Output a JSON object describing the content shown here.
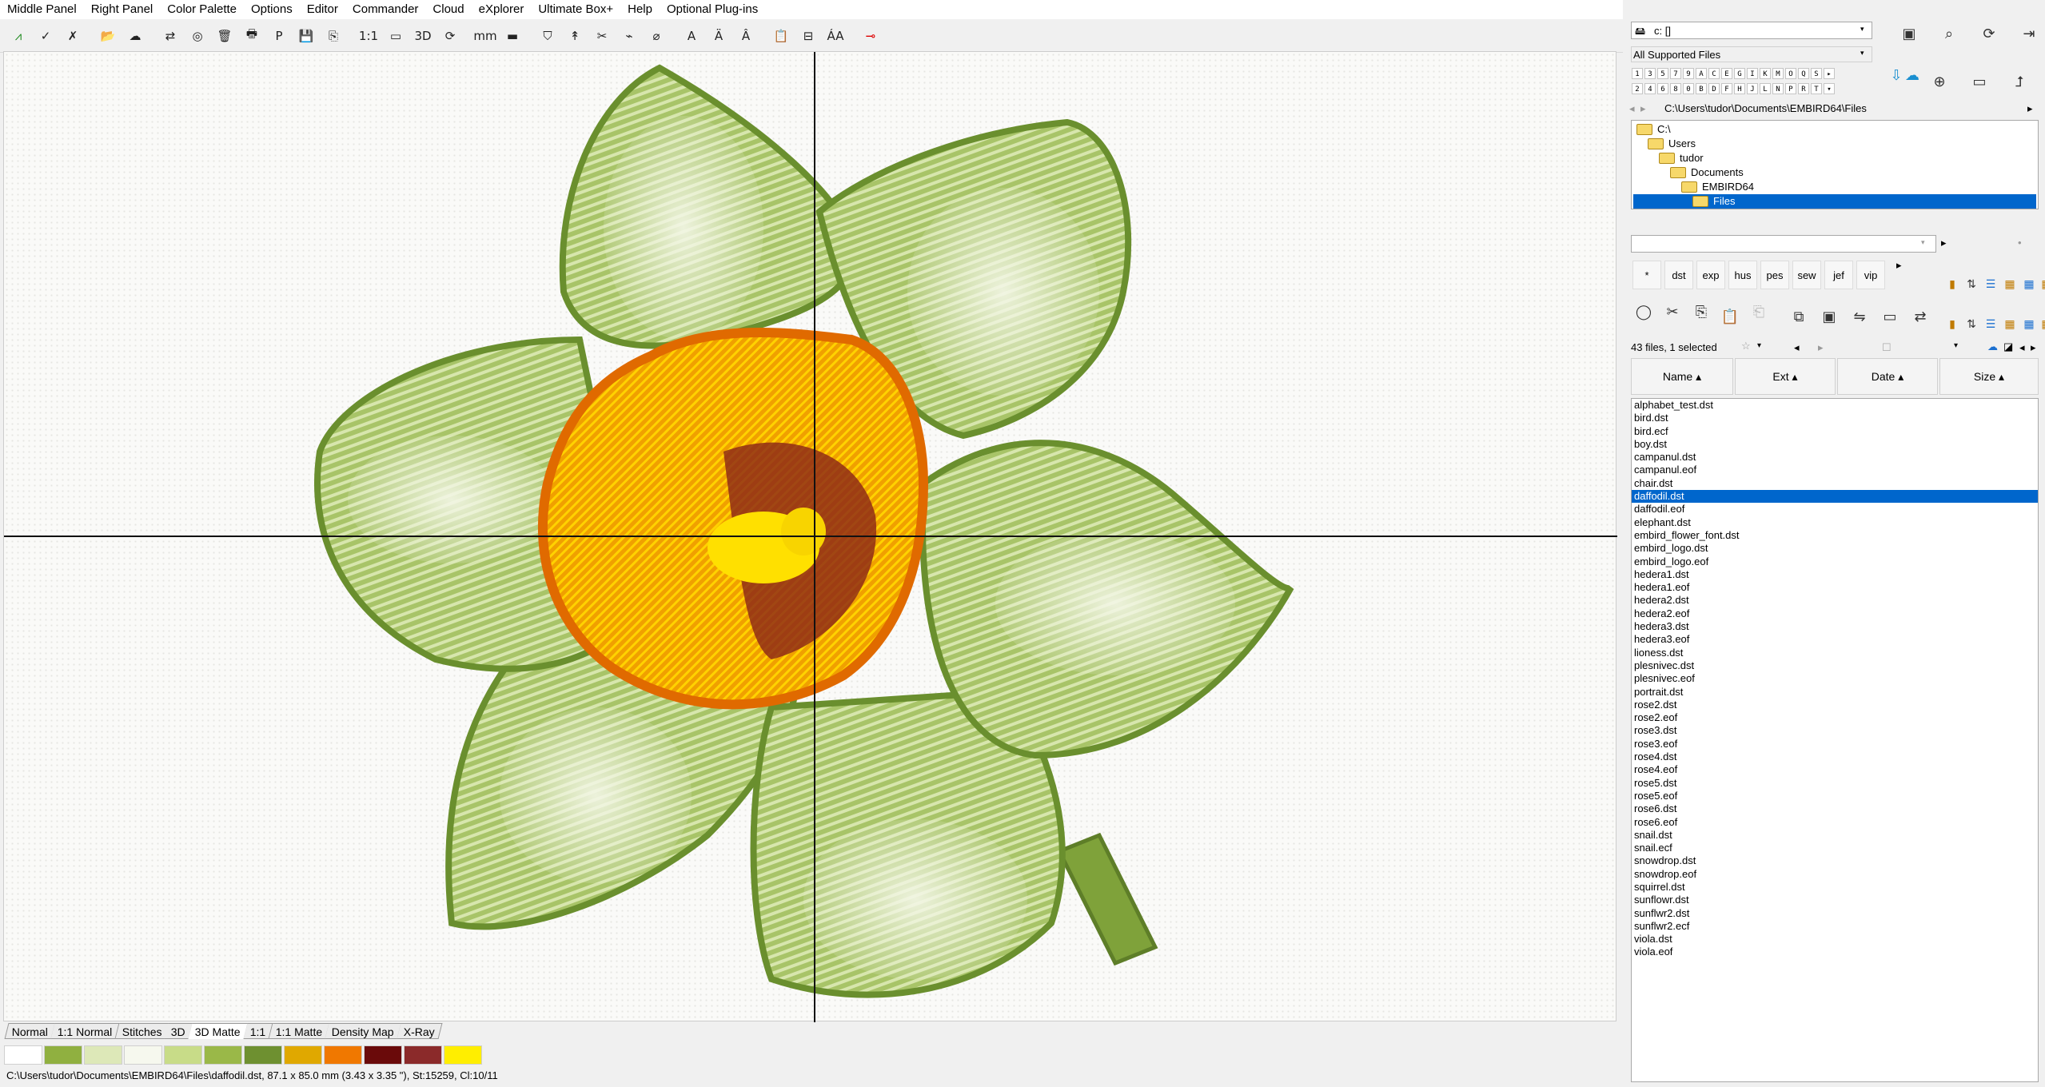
{
  "menu": [
    "Middle Panel",
    "Right Panel",
    "Color Palette",
    "Options",
    "Editor",
    "Commander",
    "Cloud",
    "eXplorer",
    "Ultimate Box+",
    "Help",
    "Optional Plug-ins"
  ],
  "toolbar": {
    "icons": [
      "stitch-logo-icon",
      "wand-check-icon",
      "wand-cross-icon",
      "open-folder-icon",
      "cloud-icon",
      "transfer-icon",
      "hoop-icon",
      "trash-icon",
      "print-icon",
      "pdf-icon",
      "save-icon",
      "save-as-icon",
      "one-to-one-icon",
      "screen-icon",
      "3d-icon",
      "rotate-icon",
      "measure-mm-icon",
      "measure-ruler-icon",
      "shield-icon",
      "needle-icon",
      "stitch-a-icon",
      "stitch-b-icon",
      "stitch-c-icon",
      "text-a-icon",
      "text-b-icon",
      "text-c-icon",
      "clipboard-icon",
      "layout-icon",
      "font-aa-icon",
      "key-red-icon"
    ],
    "glyphs": [
      "⩘",
      "✓",
      "✗",
      "📂",
      "☁",
      "⇄",
      "◎",
      "🗑",
      "🖶",
      "P",
      "💾",
      "⎘",
      "1:1",
      "▭",
      "3D",
      "⟳",
      "mm",
      "▬",
      "⛉",
      "↟",
      "✂",
      "⌁",
      "⌀",
      "A",
      "Ä",
      "Â",
      "📋",
      "⊟",
      "ÁA",
      "⊸"
    ],
    "text_labels": [
      "1:1",
      "3D",
      "mm",
      "A",
      "ÁA"
    ]
  },
  "view_tabs": [
    "Normal",
    "1:1 Normal",
    "Stitches",
    "3D",
    "3D Matte",
    "1:1",
    "1:1 Matte",
    "Density Map",
    "X-Ray"
  ],
  "active_view_tab": "3D Matte",
  "palette": [
    "#ffffff",
    "#90b040",
    "#dde8b8",
    "#f6f8ee",
    "#c8dc88",
    "#9ab848",
    "#6e9030",
    "#e0a800",
    "#f07800",
    "#6a0a0a",
    "#8b2a2a",
    "#ffee00"
  ],
  "status": "C:\\Users\\tudor\\Documents\\EMBIRD64\\Files\\daffodil.dst, 87.1 x 85.0 mm (3.43 x 3.35 \"), St:15259, Cl:10/11",
  "right_panel": {
    "drive": "c: []",
    "file_type": "All Supported Files",
    "key_rows": [
      [
        "1",
        "3",
        "5",
        "7",
        "9",
        "A",
        "C",
        "E",
        "G",
        "I",
        "K",
        "M",
        "O",
        "Q",
        "S",
        "▸"
      ],
      [
        "2",
        "4",
        "6",
        "8",
        "0",
        "B",
        "D",
        "F",
        "H",
        "J",
        "L",
        "N",
        "P",
        "R",
        "T",
        "▾"
      ]
    ],
    "path": "C:\\Users\\tudor\\Documents\\EMBIRD64\\Files",
    "tree": [
      {
        "label": "C:\\",
        "indent": 0
      },
      {
        "label": "Users",
        "indent": 1
      },
      {
        "label": "tudor",
        "indent": 2
      },
      {
        "label": "Documents",
        "indent": 3
      },
      {
        "label": "EMBIRD64",
        "indent": 4
      },
      {
        "label": "Files",
        "indent": 5,
        "selected": true
      }
    ],
    "formats": [
      "*",
      "dst",
      "exp",
      "hus",
      "pes",
      "sew",
      "jef",
      "vip"
    ],
    "file_count": "43 files, 1 selected",
    "columns": [
      "Name ▴",
      "Ext ▴",
      "Date ▴",
      "Size ▴"
    ],
    "files": [
      "alphabet_test.dst",
      "bird.dst",
      "bird.ecf",
      "boy.dst",
      "campanul.dst",
      "campanul.eof",
      "chair.dst",
      "daffodil.dst",
      "daffodil.eof",
      "elephant.dst",
      "embird_flower_font.dst",
      "embird_logo.dst",
      "embird_logo.eof",
      "hedera1.dst",
      "hedera1.eof",
      "hedera2.dst",
      "hedera2.eof",
      "hedera3.dst",
      "hedera3.eof",
      "lioness.dst",
      "plesnivec.dst",
      "plesnivec.eof",
      "portrait.dst",
      "rose2.dst",
      "rose2.eof",
      "rose3.dst",
      "rose3.eof",
      "rose4.dst",
      "rose4.eof",
      "rose5.dst",
      "rose5.eof",
      "rose6.dst",
      "rose6.eof",
      "snail.dst",
      "snail.ecf",
      "snowdrop.dst",
      "snowdrop.eof",
      "squirrel.dst",
      "sunflowr.dst",
      "sunflwr2.dst",
      "sunflwr2.ecf",
      "viola.dst",
      "viola.eof"
    ],
    "selected_file": "daffodil.dst",
    "accent": "#0066cc"
  }
}
